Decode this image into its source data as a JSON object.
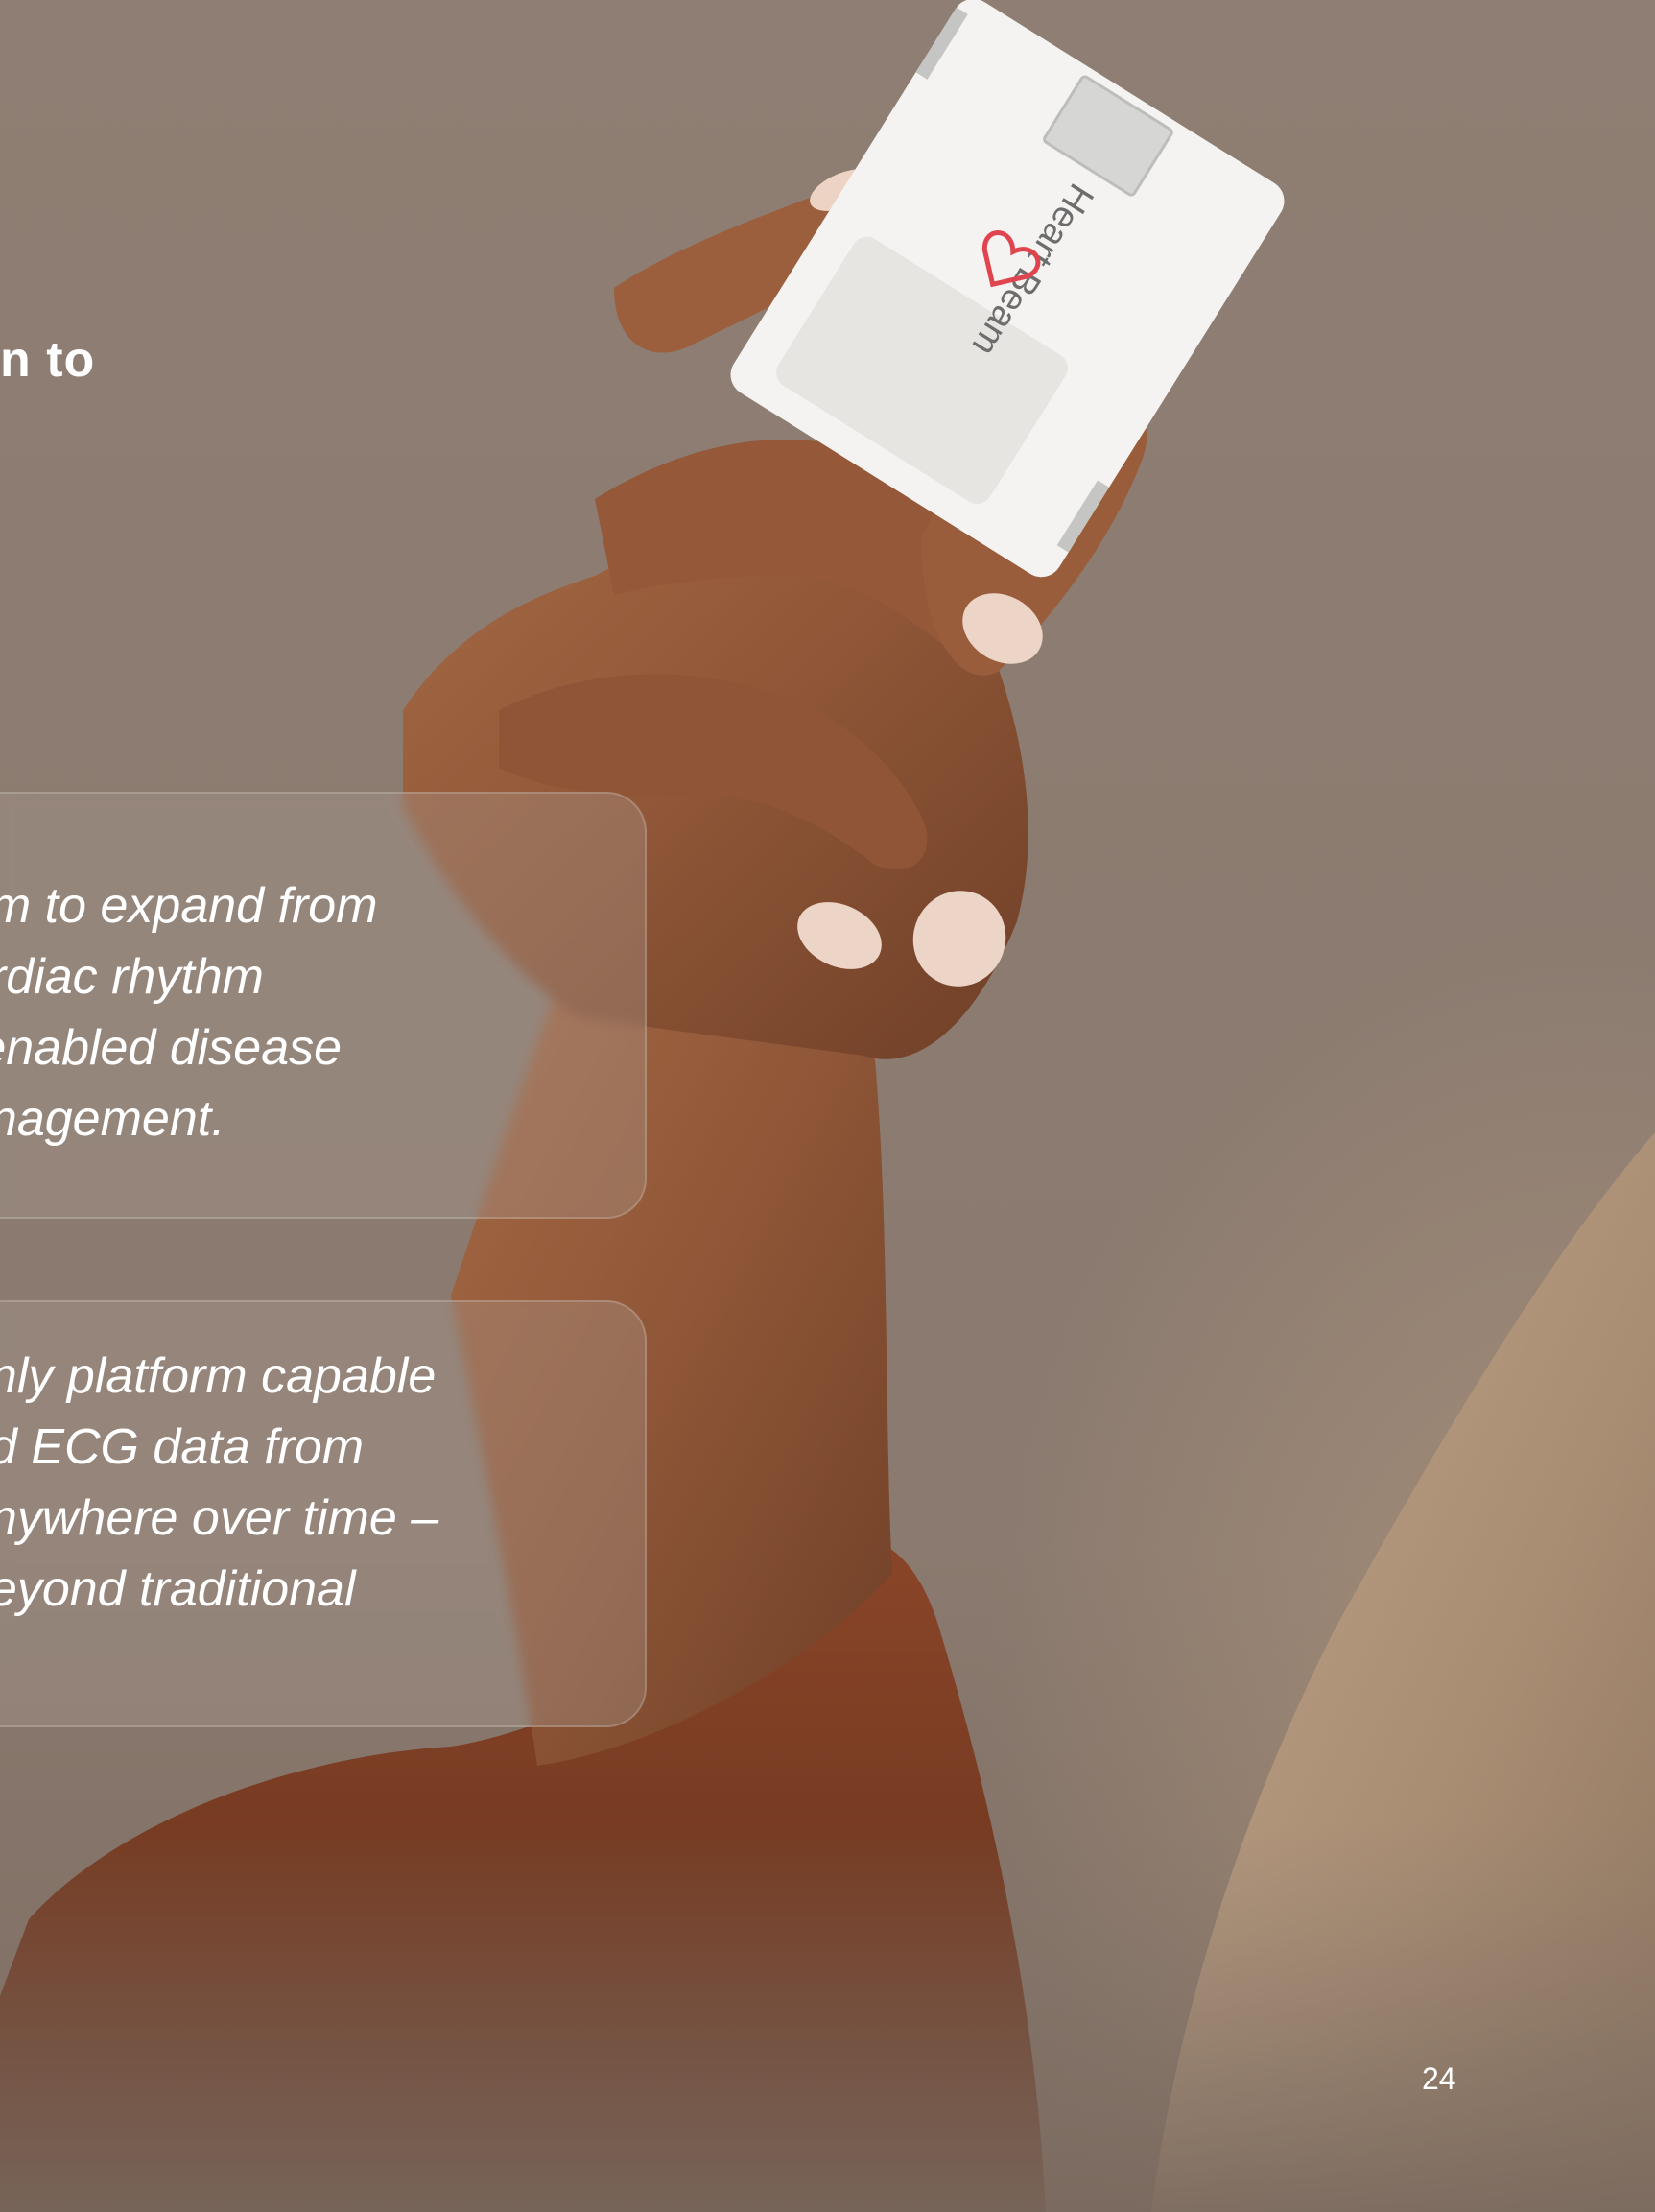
{
  "slide": {
    "title_fragment": "n to",
    "page_number": "24"
  },
  "card_1": {
    "lines": [
      "am to expand from",
      "ardiac rhythm",
      "-enabled disease",
      "anagement."
    ]
  },
  "card_2": {
    "lines": [
      "only platform capable",
      "ad ECG data from",
      "anywhere over time –",
      "beyond traditional"
    ]
  },
  "device": {
    "brand_text": "HeartBeam",
    "logo_color": "#e0454f"
  },
  "colors": {
    "background": "#8d7d71",
    "sleeve": "#7a3f24",
    "sweater": "#b89b80",
    "skin": "#9a6240"
  }
}
